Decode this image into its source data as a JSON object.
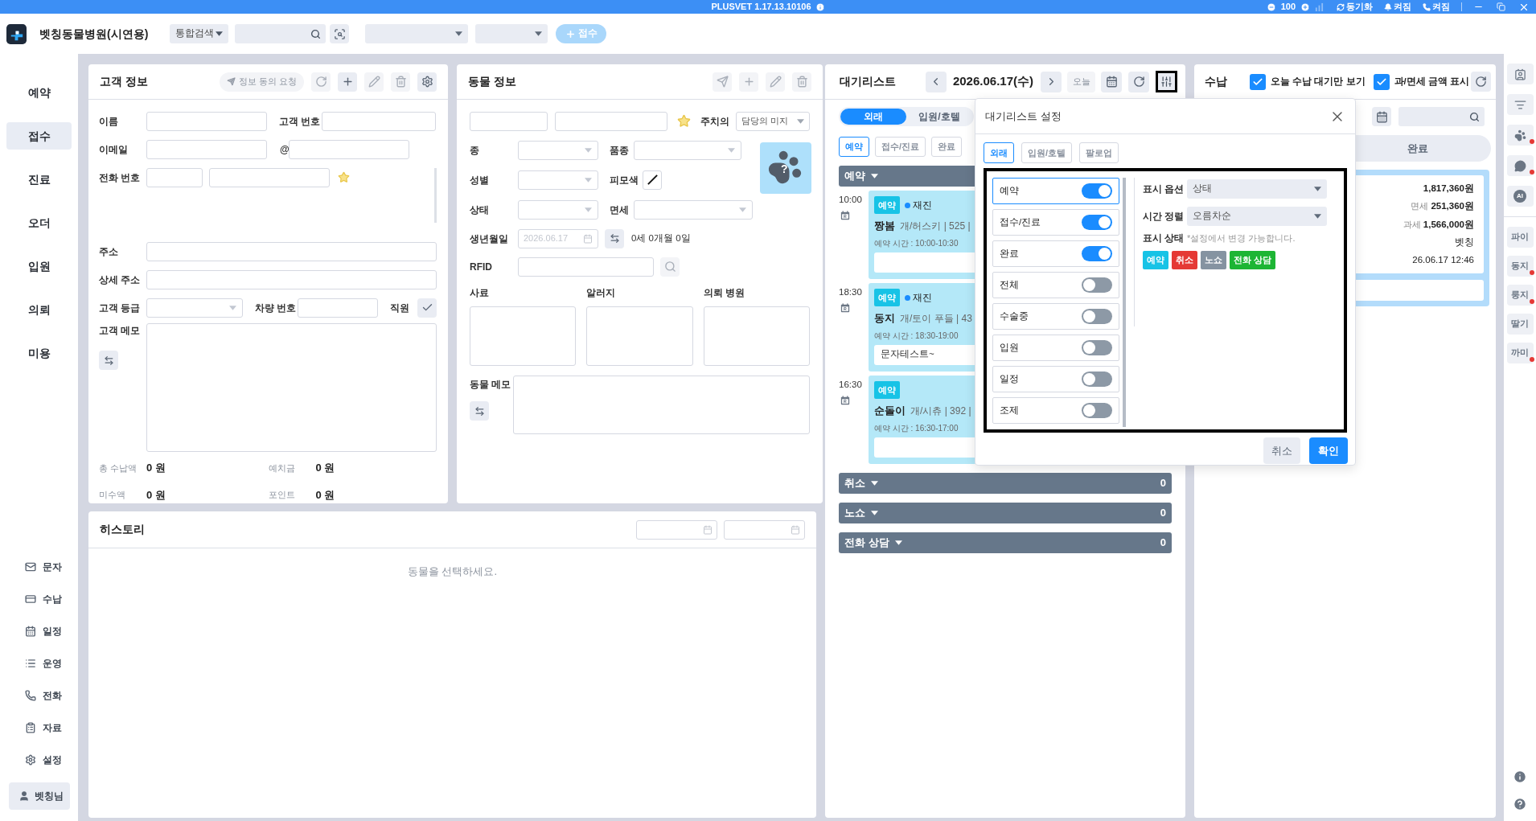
{
  "title_bar": {
    "version": "PLUSVET 1.17.13.10106",
    "zoom": "100",
    "sync": "동기화",
    "notification": "켜짐",
    "phone": "켜짐"
  },
  "header": {
    "clinic_name": "벳칭동물병원(시연용)",
    "search_scope": "통합검색",
    "register_button": "접수"
  },
  "sidebar": {
    "items": [
      {
        "label": "예약",
        "selected": false
      },
      {
        "label": "접수",
        "selected": true
      },
      {
        "label": "진료",
        "selected": false
      },
      {
        "label": "오더",
        "selected": false
      },
      {
        "label": "입원",
        "selected": false
      },
      {
        "label": "의뢰",
        "selected": false
      },
      {
        "label": "미용",
        "selected": false
      }
    ],
    "tools": [
      {
        "label": "문자"
      },
      {
        "label": "수납"
      },
      {
        "label": "일정"
      },
      {
        "label": "운영"
      },
      {
        "label": "전화"
      },
      {
        "label": "자료"
      },
      {
        "label": "설정"
      }
    ],
    "user": "벳칭님"
  },
  "customer_info": {
    "title": "고객 정보",
    "consent_button": "정보 동의 요청",
    "name_label": "이름",
    "number_label": "고객 번호",
    "email_label": "이메일",
    "email_at": "@",
    "phone_label": "전화 번호",
    "address_label": "주소",
    "detail_address_label": "상세 주소",
    "grade_label": "고객 등급",
    "car_label": "차량 번호",
    "staff_label": "직원",
    "memo_label": "고객 메모",
    "totals": [
      {
        "label": "총 수납액",
        "value": "0 원"
      },
      {
        "label": "예치금",
        "value": "0 원"
      },
      {
        "label": "미수액",
        "value": "0 원"
      },
      {
        "label": "포인트",
        "value": "0 원"
      }
    ]
  },
  "animal_info": {
    "title": "동물 정보",
    "doctor_label": "주치의",
    "doctor_value": "담당의 미지",
    "species_label": "종",
    "breed_label": "품종",
    "sex_label": "성별",
    "coat_label": "피모색",
    "status_label": "상태",
    "tax_label": "면세",
    "birth_label": "생년월일",
    "birth_placeholder": "2026.06.17",
    "age": "0세 0개월 0일",
    "rfid_label": "RFID",
    "photo_mark": "?",
    "notes": [
      "사료",
      "알러지",
      "의뢰 병원"
    ],
    "memo_label": "동물 메모"
  },
  "history": {
    "title": "히스토리",
    "empty_message": "동물을 선택하세요."
  },
  "waitlist": {
    "title": "대기리스트",
    "date": "2026.06.17(수)",
    "today_button": "오늘",
    "segments": [
      {
        "label": "외래",
        "selected": true
      },
      {
        "label": "입원/호텔",
        "selected": false
      }
    ],
    "filters": [
      {
        "label": "예약",
        "selected": true
      },
      {
        "label": "접수/진료",
        "selected": false
      },
      {
        "label": "완료",
        "selected": false
      }
    ],
    "groups": [
      {
        "label": "예약",
        "entries": [
          {
            "time": "10:00",
            "badge": "예약",
            "visit": "재진",
            "name": "짱봄",
            "detail": "개/허스키 | 525 |",
            "schedule": "예약 시간 : 10:00-10:30"
          },
          {
            "time": "18:30",
            "badge": "예약",
            "visit": "재진",
            "name": "동지",
            "detail": "개/토이 푸들 | 43",
            "schedule": "예약 시간 : 18:30-19:00",
            "memo": "문자테스트~"
          },
          {
            "time": "16:30",
            "badge": "예약",
            "name": "순돌이",
            "detail": "개/시츄 | 392 |",
            "schedule": "예약 시간 : 16:30-17:00"
          }
        ]
      },
      {
        "label": "취소",
        "count": "0"
      },
      {
        "label": "노쇼",
        "count": "0"
      },
      {
        "label": "전화 상담",
        "count": "0"
      }
    ]
  },
  "waitlist_settings": {
    "title": "대기리스트 설정",
    "tabs": [
      {
        "label": "외래",
        "selected": true
      },
      {
        "label": "입원/호텔",
        "selected": false
      },
      {
        "label": "팔로업",
        "selected": false
      }
    ],
    "toggles": [
      {
        "label": "예약",
        "on": true,
        "selected": true
      },
      {
        "label": "접수/진료",
        "on": true,
        "selected": false
      },
      {
        "label": "완료",
        "on": true,
        "selected": false
      },
      {
        "label": "전체",
        "on": false,
        "selected": false
      },
      {
        "label": "수술중",
        "on": false,
        "selected": false
      },
      {
        "label": "입원",
        "on": false,
        "selected": false
      },
      {
        "label": "일정",
        "on": false,
        "selected": false
      },
      {
        "label": "조제",
        "on": false,
        "selected": false
      }
    ],
    "display_option_label": "표시 옵션",
    "display_option": "상태",
    "sort_label": "시간 정렬",
    "sort": "오름차순",
    "status_label": "표시 상태",
    "status_hint": "*설정에서 변경 가능합니다.",
    "statuses": [
      {
        "label": "예약",
        "color": "#17c3e6"
      },
      {
        "label": "취소",
        "color": "#e53935"
      },
      {
        "label": "노쇼",
        "color": "#8593a1"
      },
      {
        "label": "전화 상담",
        "color": "#1db534"
      }
    ],
    "cancel_button": "취소",
    "confirm_button": "확인"
  },
  "payment": {
    "title": "수납",
    "options": [
      {
        "label": "오늘 수납 대기만 보기",
        "checked": true
      },
      {
        "label": "과/면세 금액 표시",
        "checked": true
      }
    ],
    "segment": "완료",
    "summary": {
      "total": "1,817,360원",
      "lines": [
        {
          "label": "면세",
          "value": "251,360원"
        },
        {
          "label": "과세",
          "value": "1,566,000원"
        }
      ],
      "name": "벳칭",
      "datetime": "26.06.17 12:46"
    }
  },
  "right_bar": {
    "tools": [
      {
        "alert": false
      },
      {
        "alert": false
      },
      {
        "alert": true
      },
      {
        "alert": true
      },
      {
        "label": "AI",
        "alert": false
      }
    ],
    "patients": [
      {
        "name": "파이",
        "alert": false
      },
      {
        "name": "동지",
        "alert": true
      },
      {
        "name": "룽지",
        "alert": true
      },
      {
        "name": "딸기",
        "alert": false
      },
      {
        "name": "까미",
        "alert": true
      }
    ]
  }
}
